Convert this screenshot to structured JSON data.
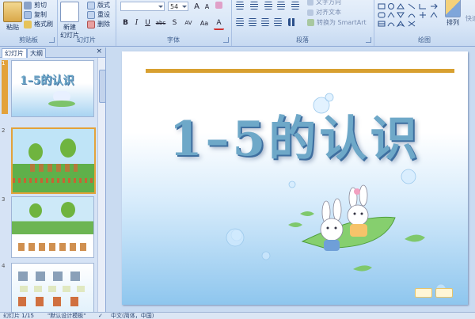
{
  "ribbon": {
    "clipboard": {
      "paste": "粘贴",
      "cut": "剪切",
      "copy": "复制",
      "format_painter": "格式刷",
      "label": "剪贴板"
    },
    "slides": {
      "new_slide": "新建",
      "new_slide_2": "幻灯片",
      "layout": "版式",
      "reset": "重设",
      "delete": "删除",
      "label": "幻灯片"
    },
    "font": {
      "size": "54",
      "label": "字体",
      "bold": "B",
      "italic": "I",
      "underline": "U",
      "strike": "abc",
      "shadow": "S",
      "spacing": "AV",
      "case": "Aa",
      "color": "A",
      "grow": "A",
      "shrink": "A"
    },
    "paragraph": {
      "text_direction": "文字方向",
      "align_text": "对齐文本",
      "smartart": "转换为 SmartArt",
      "label": "段落"
    },
    "drawing": {
      "arrange": "排列",
      "quick_styles": "快速",
      "label": "绘图"
    }
  },
  "pane": {
    "tab_slides": "幻灯片",
    "tab_outline": "大纲",
    "close": "×",
    "thumbs": [
      {
        "num": "1",
        "caption": "1–5的认识"
      },
      {
        "num": "2"
      },
      {
        "num": "3"
      },
      {
        "num": "4"
      }
    ]
  },
  "slide": {
    "title": "1–5的认识"
  },
  "status": {
    "slide_of": "幻灯片 1/15",
    "theme": "\"默认设计模板\"",
    "language": "中文(简体，中国)"
  },
  "colors": {
    "ribbon": "#d8e6f7",
    "accent_line": "#d8a030",
    "title": "#6ea8c8",
    "selected_thumb": "#e3a23a"
  }
}
